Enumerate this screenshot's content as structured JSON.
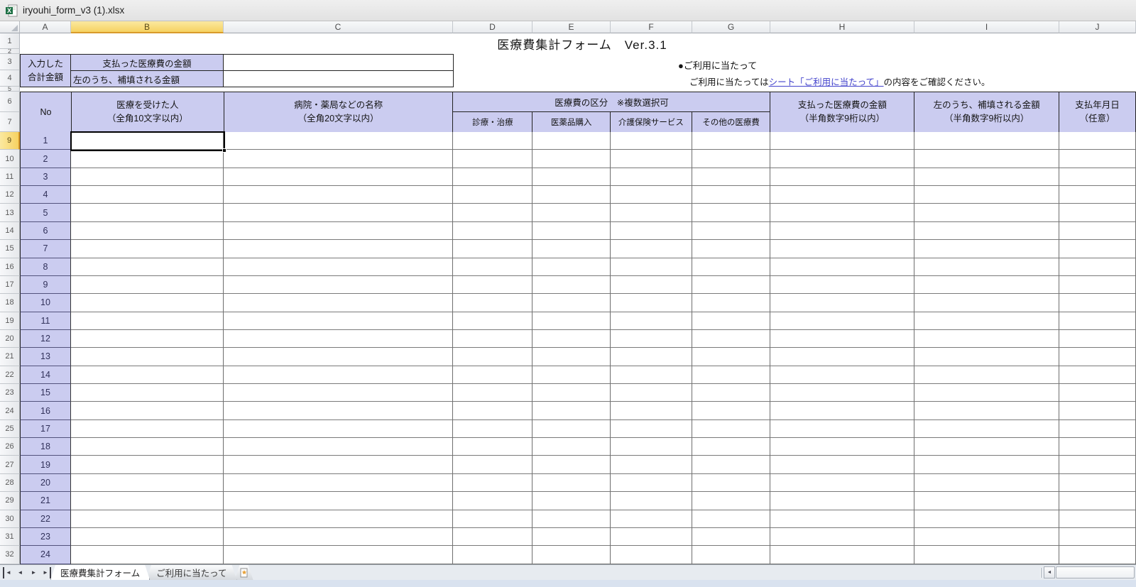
{
  "window": {
    "title": "iryouhi_form_v3 (1).xlsx"
  },
  "selection": {
    "active_column": "B",
    "active_row": "9",
    "active_cell": "B9"
  },
  "grid": {
    "columns": [
      "A",
      "B",
      "C",
      "D",
      "E",
      "F",
      "G",
      "H",
      "I",
      "J"
    ],
    "top_rows": [
      "1",
      "2",
      "3",
      "4",
      "5",
      "6",
      "7"
    ]
  },
  "form": {
    "title": "医療費集計フォーム　Ver.3.1",
    "summary": {
      "row_label_line1": "入力した",
      "row_label_line2": "合計金額",
      "paid_label": "支払った医療費の金額",
      "refund_label": "左のうち、補填される金額",
      "paid_value": "",
      "refund_value": ""
    },
    "notice": {
      "heading": "●ご利用に当たって",
      "text_before_link": "ご利用に当たっては",
      "link_text": "シート「ご利用に当たって」",
      "text_after_link": "の内容をご確認ください。"
    }
  },
  "table": {
    "header": {
      "no": "No",
      "person_line1": "医療を受けた人",
      "person_line2": "（全角10文字以内）",
      "hospital_line1": "病院・薬局などの名称",
      "hospital_line2": "（全角20文字以内）",
      "category_group": "医療費の区分　※複数選択可",
      "cat1": "診療・治療",
      "cat2": "医薬品購入",
      "cat3": "介護保険サービス",
      "cat4": "その他の医療費",
      "paid_line1": "支払った医療費の金額",
      "paid_line2": "（半角数字9桁以内）",
      "refund_line1": "左のうち、補填される金額",
      "refund_line2": "（半角数字9桁以内）",
      "date_line1": "支払年月日",
      "date_line2": "（任意）"
    },
    "rows": [
      {
        "excel_row": "9",
        "no": "1"
      },
      {
        "excel_row": "10",
        "no": "2"
      },
      {
        "excel_row": "11",
        "no": "3"
      },
      {
        "excel_row": "12",
        "no": "4"
      },
      {
        "excel_row": "13",
        "no": "5"
      },
      {
        "excel_row": "14",
        "no": "6"
      },
      {
        "excel_row": "15",
        "no": "7"
      },
      {
        "excel_row": "16",
        "no": "8"
      },
      {
        "excel_row": "17",
        "no": "9"
      },
      {
        "excel_row": "18",
        "no": "10"
      },
      {
        "excel_row": "19",
        "no": "11"
      },
      {
        "excel_row": "20",
        "no": "12"
      },
      {
        "excel_row": "21",
        "no": "13"
      },
      {
        "excel_row": "22",
        "no": "14"
      },
      {
        "excel_row": "23",
        "no": "15"
      },
      {
        "excel_row": "24",
        "no": "16"
      },
      {
        "excel_row": "25",
        "no": "17"
      },
      {
        "excel_row": "26",
        "no": "18"
      },
      {
        "excel_row": "27",
        "no": "19"
      },
      {
        "excel_row": "28",
        "no": "20"
      },
      {
        "excel_row": "29",
        "no": "21"
      },
      {
        "excel_row": "30",
        "no": "22"
      },
      {
        "excel_row": "31",
        "no": "23"
      },
      {
        "excel_row": "32",
        "no": "24"
      }
    ]
  },
  "sheet_tabs": {
    "nav_first": "◄",
    "nav_prev": "◄",
    "nav_next": "►",
    "nav_last": "►",
    "tabs": [
      {
        "label": "医療費集計フォーム",
        "active": true
      },
      {
        "label": "ご利用に当たって",
        "active": false
      }
    ]
  },
  "colors": {
    "header_fill": "#CBCCF0",
    "selected_header_fill": "#F6D261",
    "link": "#4343CC",
    "grid_line": "#6E6E6E"
  }
}
